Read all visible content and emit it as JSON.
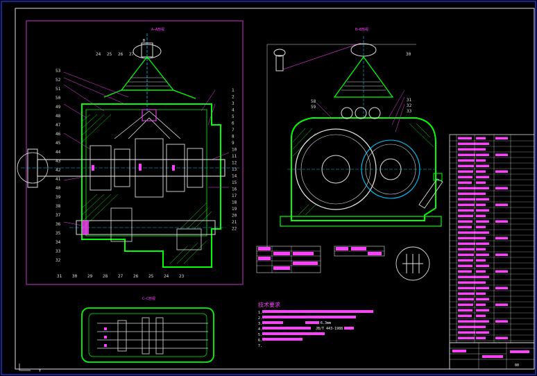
{
  "drawing": {
    "section_aa_label": "A—A剖视",
    "section_bb_label": "B—B剖视",
    "section_cc_label": "C—C剖视",
    "tech_title": "技术要求",
    "tech_lines": [
      "1.",
      "2.",
      "3.",
      "4.",
      "5.",
      "6.",
      "7."
    ],
    "tech_partial_1": "6.3mm",
    "tech_partial_2": "JB/T 443-1988",
    "title_block_code": "00",
    "a_marker": "A",
    "b_marker": "B",
    "front_callouts_left": [
      "53",
      "52",
      "51",
      "50",
      "49",
      "48",
      "47",
      "46",
      "45",
      "44",
      "43",
      "42",
      "41",
      "40",
      "39",
      "38",
      "37",
      "36",
      "35",
      "34",
      "33",
      "32"
    ],
    "front_callouts_right": [
      "1",
      "2",
      "3",
      "4",
      "5",
      "6",
      "7",
      "8",
      "9",
      "10",
      "11",
      "12",
      "13",
      "14",
      "15",
      "16",
      "17",
      "18",
      "19",
      "20",
      "21",
      "22"
    ],
    "front_callouts_top": [
      "24",
      "25",
      "26",
      "27"
    ],
    "front_callouts_bottom": [
      "31",
      "30",
      "29",
      "28",
      "27",
      "26",
      "25",
      "24",
      "23"
    ],
    "side_callouts": [
      "30",
      "58",
      "59",
      "31",
      "32",
      "33"
    ]
  },
  "colors": {
    "background": "#000000",
    "outline": "#00ff00",
    "detail": "#ffffff",
    "annotation": "#ff00ff",
    "frame": "#0000ff",
    "accent": "#00c8ff"
  }
}
